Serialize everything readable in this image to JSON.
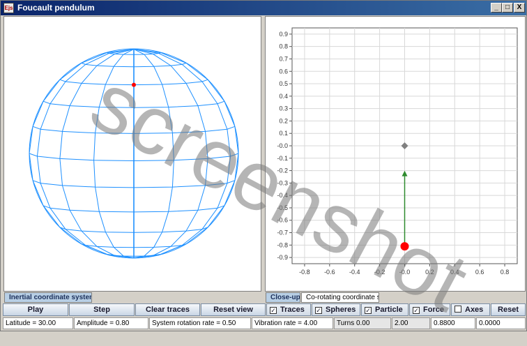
{
  "window": {
    "title": "Foucault pendulum",
    "icon_text": "Ejs",
    "controls": [
      "_",
      "□",
      "X"
    ]
  },
  "tabs": {
    "left_active": "Inertial coordinate system",
    "right_active": "Close-up",
    "right_inactive": "Co-rotating coordinate s..."
  },
  "buttons": {
    "play": "Play",
    "step": "Step",
    "clear_traces": "Clear traces",
    "reset_view": "Reset view",
    "reset": "Reset"
  },
  "checkboxes": [
    {
      "label": "Traces",
      "checked": true
    },
    {
      "label": "Spheres",
      "checked": true
    },
    {
      "label": "Particle",
      "checked": true
    },
    {
      "label": "Force",
      "checked": true
    },
    {
      "label": "Axes",
      "checked": false
    }
  ],
  "status": {
    "latitude": "Latitude = 30.00",
    "amplitude": "Amplitude = 0.80",
    "rotation_rate": "System rotation rate = 0.50",
    "vibration_rate": "Vibration rate = 4.00",
    "turns_label": "Turns 0.00",
    "value_1": "2.00",
    "value_2": "0.8800",
    "value_3": "0.0000"
  },
  "watermark": "screenshot",
  "chart_data": {
    "type": "scatter",
    "xlim": [
      -0.9,
      0.9
    ],
    "ylim": [
      -0.95,
      0.95
    ],
    "xticks": [
      -0.8,
      -0.6,
      -0.4,
      -0.2,
      0.0,
      0.2,
      0.4,
      0.6,
      0.8
    ],
    "yticks": [
      0.9,
      0.8,
      0.7,
      0.6,
      0.5,
      0.4,
      0.3,
      0.2,
      0.1,
      0.0,
      -0.1,
      -0.2,
      -0.3,
      -0.4,
      -0.5,
      -0.6,
      -0.7,
      -0.8,
      -0.9
    ],
    "xtick_labels": [
      "-0.8",
      "-0.6",
      "-0.4",
      "-0.2",
      "-0.0",
      "0.2",
      "0.4",
      "0.6",
      "0.8"
    ],
    "ytick_labels": [
      "0.9",
      "0.8",
      "0.7",
      "0.6",
      "0.5",
      "0.4",
      "0.3",
      "0.2",
      "0.1",
      "-0.0",
      "-0.1",
      "-0.2",
      "-0.3",
      "-0.4",
      "-0.5",
      "-0.6",
      "-0.7",
      "-0.8",
      "-0.9"
    ],
    "grid": true,
    "pivot": {
      "x": 0.0,
      "y": 0.0,
      "color": "#808080"
    },
    "particle": {
      "x": 0.0,
      "y": -0.81,
      "color": "#ff0000"
    },
    "force_arrow": {
      "x": 0.0,
      "y0": -0.81,
      "y1": -0.2,
      "color": "#2e8b2e"
    }
  },
  "colors": {
    "sphere": "#1e90ff",
    "sphere_dot": "#ff0000",
    "title_bar": "#0a246a",
    "tab_active": "#b8cfe5"
  }
}
